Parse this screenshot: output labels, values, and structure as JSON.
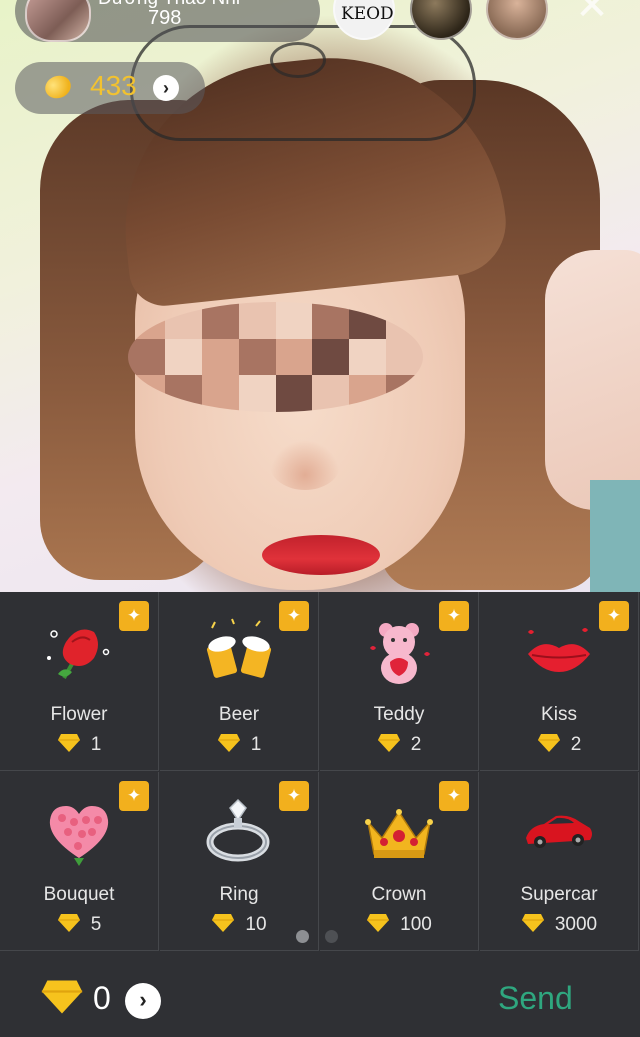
{
  "host": {
    "name": "Dương Thảo Nhi",
    "viewer_count": "798"
  },
  "viewers": [
    {
      "avatar_text": "KEOD"
    },
    {
      "avatar_text": ""
    },
    {
      "avatar_text": ""
    }
  ],
  "coins": {
    "value": "433",
    "arrow_icon": "chevron-right-icon"
  },
  "gifts": [
    {
      "name": "Flower",
      "price": "1",
      "icon": "rose-icon"
    },
    {
      "name": "Beer",
      "price": "1",
      "icon": "beer-icon"
    },
    {
      "name": "Teddy",
      "price": "2",
      "icon": "teddy-bear-icon"
    },
    {
      "name": "Kiss",
      "price": "2",
      "icon": "lips-icon"
    },
    {
      "name": "Bouquet",
      "price": "5",
      "icon": "heart-bouquet-icon"
    },
    {
      "name": "Ring",
      "price": "10",
      "icon": "ring-icon"
    },
    {
      "name": "Crown",
      "price": "100",
      "icon": "crown-icon"
    },
    {
      "name": "Supercar",
      "price": "3000",
      "icon": "car-icon"
    }
  ],
  "pager": {
    "pages": 2,
    "active": 0
  },
  "balance": {
    "value": "0"
  },
  "send_label": "Send",
  "colors": {
    "accent": "#2fa77f",
    "gold": "#f2b01d",
    "coin": "#f2c230",
    "panel": "#2f3034"
  }
}
